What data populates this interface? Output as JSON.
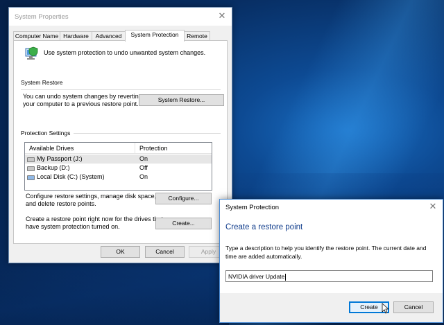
{
  "system_properties": {
    "title": "System Properties",
    "tabs": [
      "Computer Name",
      "Hardware",
      "Advanced",
      "System Protection",
      "Remote"
    ],
    "active_tab": "System Protection",
    "intro_text": "Use system protection to undo unwanted system changes.",
    "system_restore": {
      "header": "System Restore",
      "text_line1": "You can undo system changes by reverting",
      "text_line2": "your computer to a previous restore point.",
      "button": "System Restore..."
    },
    "protection_settings": {
      "header": "Protection Settings",
      "columns": [
        "Available Drives",
        "Protection"
      ],
      "drives": [
        {
          "name": "My Passport (J:)",
          "protection": "On",
          "icon": "external-drive-icon"
        },
        {
          "name": "Backup (D:)",
          "protection": "Off",
          "icon": "drive-icon"
        },
        {
          "name": "Local Disk (C:) (System)",
          "protection": "On",
          "icon": "system-drive-icon"
        }
      ],
      "configure_text_line1": "Configure restore settings, manage disk space,",
      "configure_text_line2": "and delete restore points.",
      "configure_button": "Configure...",
      "create_text_line1": "Create a restore point right now for the drives that",
      "create_text_line2": "have system protection turned on.",
      "create_button": "Create..."
    },
    "footer": {
      "ok": "OK",
      "cancel": "Cancel",
      "apply": "Apply"
    }
  },
  "create_dialog": {
    "title": "System Protection",
    "heading": "Create a restore point",
    "description": "Type a description to help you identify the restore point. The current date and time are added automatically.",
    "input_value": "NVIDIA driver Update",
    "create_button": "Create",
    "cancel_button": "Cancel"
  },
  "colors": {
    "heading": "#0d3a8a",
    "accent": "#0078d7",
    "desktop": "#0d4a93"
  }
}
